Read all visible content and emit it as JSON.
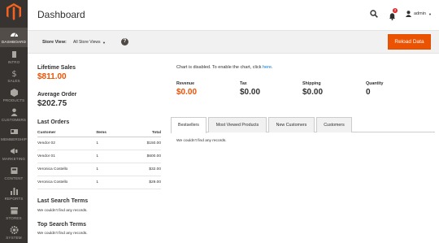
{
  "header": {
    "title": "Dashboard",
    "user": "admin",
    "notification_count": "2"
  },
  "sidebar": {
    "items": [
      {
        "label": "DASHBOARD",
        "icon": "dashboard-icon"
      },
      {
        "label": "INTRO",
        "icon": "intro-icon"
      },
      {
        "label": "SALES",
        "icon": "dollar-icon"
      },
      {
        "label": "PRODUCTS",
        "icon": "cube-icon"
      },
      {
        "label": "CUSTOMERS",
        "icon": "person-icon"
      },
      {
        "label": "MEMBERSHIP",
        "icon": "membership-icon"
      },
      {
        "label": "MARKETING",
        "icon": "megaphone-icon"
      },
      {
        "label": "CONTENT",
        "icon": "content-icon"
      },
      {
        "label": "REPORTS",
        "icon": "bar-chart-icon"
      },
      {
        "label": "STORES",
        "icon": "store-icon"
      },
      {
        "label": "SYSTEM",
        "icon": "gear-icon"
      }
    ]
  },
  "store_bar": {
    "label": "Store View:",
    "selected": "All Store Views",
    "reload_label": "Reload Data"
  },
  "summary": {
    "lifetime_sales_label": "Lifetime Sales",
    "lifetime_sales_value": "$811.00",
    "avg_order_label": "Average Order",
    "avg_order_value": "$202.75"
  },
  "last_orders": {
    "title": "Last Orders",
    "columns": [
      "Customer",
      "Items",
      "Total"
    ],
    "rows": [
      {
        "customer": "Vendor 02",
        "items": "1",
        "total": "$150.00"
      },
      {
        "customer": "Vendor 01",
        "items": "1",
        "total": "$600.00"
      },
      {
        "customer": "Veronica Costello",
        "items": "1",
        "total": "$32.00"
      },
      {
        "customer": "Veronica Costello",
        "items": "1",
        "total": "$29.00"
      }
    ]
  },
  "last_search": {
    "title": "Last Search Terms",
    "empty": "We couldn't find any records."
  },
  "top_search": {
    "title": "Top Search Terms",
    "empty": "We couldn't find any records."
  },
  "chart": {
    "message": "Chart is disabled. To enable the chart, click ",
    "link": "here",
    "suffix": "."
  },
  "stats": [
    {
      "label": "Revenue",
      "value": "$0.00"
    },
    {
      "label": "Tax",
      "value": "$0.00"
    },
    {
      "label": "Shipping",
      "value": "$0.00"
    },
    {
      "label": "Quantity",
      "value": "0"
    }
  ],
  "tabs": [
    {
      "label": "Bestsellers"
    },
    {
      "label": "Most Viewed Products"
    },
    {
      "label": "New Customers"
    },
    {
      "label": "Customers"
    }
  ],
  "tab_content": "We couldn't find any records.",
  "colors": {
    "accent": "#eb5202",
    "sidebar_bg": "#373330",
    "link": "#007bdb"
  }
}
